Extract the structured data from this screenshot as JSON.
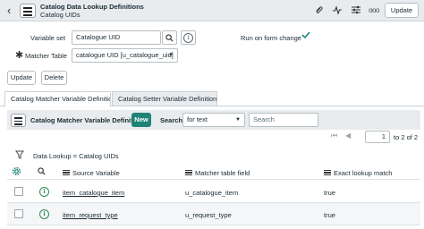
{
  "header": {
    "title": "Catalog Data Lookup Definitions",
    "subtitle": "Catalog UIDs",
    "update_label": "Update",
    "more_label": "ooo"
  },
  "form": {
    "variable_set_label": "Variable set",
    "variable_set_value": "Catalogue UID",
    "matcher_table_label": "Matcher Table",
    "matcher_table_value": "catalogue UID [u_catalogue_uid]",
    "run_on_form_change_label": "Run on form change",
    "run_on_form_change_checked": true,
    "update_label": "Update",
    "delete_label": "Delete"
  },
  "tabs": [
    {
      "label": "Catalog Matcher Variable Definitio...",
      "active": true
    },
    {
      "label": "Catalog Setter Variable Definitions...",
      "active": false
    }
  ],
  "list": {
    "title": "Catalog Matcher Variable Definitions",
    "new_label": "New",
    "search_label": "Search",
    "search_field_value": "for text",
    "search_placeholder": "Search",
    "page_input": "1",
    "page_of": "to 2 of 2",
    "breadcrumb": "Data Lookup = Catalog UIDs",
    "columns": [
      "Source Variable",
      "Matcher table field",
      "Exact lookup match"
    ],
    "rows": [
      {
        "source_variable": "item_catalogue_item",
        "matcher_field": "u_catalogue_item",
        "exact": "true"
      },
      {
        "source_variable": "item_request_type",
        "matcher_field": "u_request_type",
        "exact": "true"
      }
    ]
  },
  "colors": {
    "accent": "#1f8476",
    "header_bg": "#e9ecee",
    "info_green": "#2e8b57"
  }
}
